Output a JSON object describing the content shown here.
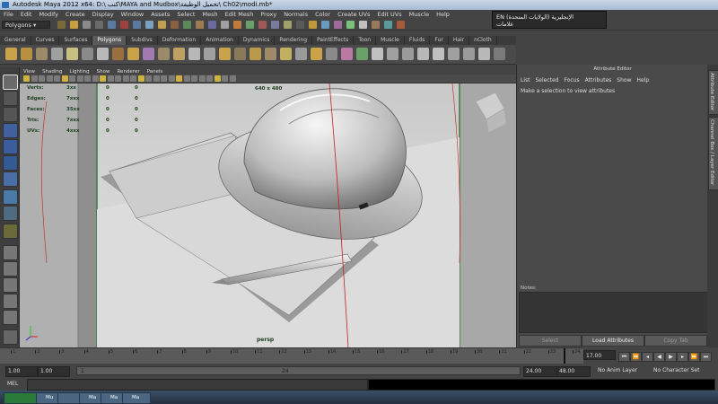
{
  "window": {
    "title": "Autodesk Maya 2012 x64: D:\\ كنب\\MAYA and Mudbox\\تحميل الوظيفة\\ Ch02\\modi.mb*"
  },
  "language_popup": {
    "line1": "EN الإنجليزية (الولايات المتحدة)",
    "line2": "علامات"
  },
  "menubar": {
    "items": [
      "File",
      "Edit",
      "Modify",
      "Create",
      "Display",
      "Window",
      "Assets",
      "Select",
      "Mesh",
      "Edit Mesh",
      "Proxy",
      "Normals",
      "Color",
      "Create UVs",
      "Edit UVs",
      "Muscle",
      "Help"
    ]
  },
  "status_line": {
    "mode": "Polygons"
  },
  "shelf": {
    "tabs": [
      "General",
      "Curves",
      "Surfaces",
      "Polygons",
      "Subdivs",
      "Deformation",
      "Animation",
      "Dynamics",
      "Rendering",
      "PaintEffects",
      "Toon",
      "Muscle",
      "Fluids",
      "Fur",
      "Hair",
      "nCloth",
      "Custom",
      "DMM"
    ],
    "active_tab": "Polygons"
  },
  "panel": {
    "menus": [
      "View",
      "Shading",
      "Lighting",
      "Show",
      "Renderer",
      "Panels"
    ]
  },
  "hud": {
    "rows": [
      {
        "label": "Verts:",
        "v1": "3xx",
        "v2": "0",
        "v3": "0"
      },
      {
        "label": "Edges:",
        "v1": "7xxx",
        "v2": "0",
        "v3": "0"
      },
      {
        "label": "Faces:",
        "v1": "35xx",
        "v2": "0",
        "v3": "0"
      },
      {
        "label": "Tris:",
        "v1": "7xxx",
        "v2": "0",
        "v3": "0"
      },
      {
        "label": "UVs:",
        "v1": "4xxx",
        "v2": "0",
        "v3": "0"
      }
    ],
    "resolution": "640 x 480",
    "camera": "persp"
  },
  "attribute_editor": {
    "title": "Attribute Editor",
    "menus": [
      "List",
      "Selected",
      "Focus",
      "Attributes",
      "Show",
      "Help"
    ],
    "hint": "Make a selection to view attributes",
    "notes_label": "Notes:",
    "buttons": {
      "select": "Select",
      "load": "Load Attributes",
      "copy": "Copy Tab"
    }
  },
  "side_tabs": [
    "Attribute Editor",
    "Channel Box / Layer Editor"
  ],
  "time_slider": {
    "tick_labels": [
      "1",
      "2",
      "3",
      "4",
      "5",
      "6",
      "7",
      "8",
      "9",
      "10",
      "11",
      "12",
      "13",
      "14",
      "15",
      "16",
      "17",
      "18",
      "19",
      "20",
      "21",
      "22",
      "23",
      "24"
    ],
    "current_frame": "17.00"
  },
  "range": {
    "start": "1.00",
    "play_start": "1.00",
    "slider_start": "1",
    "slider_end": "24",
    "play_end": "24.00",
    "end": "48.00",
    "anim_layer": "No Anim Layer",
    "character_set": "No Character Set"
  },
  "command_line": {
    "label": "MEL"
  },
  "taskbar": {
    "items": [
      "",
      "Mu",
      "",
      "Ma",
      "Ma",
      "Ma"
    ]
  }
}
